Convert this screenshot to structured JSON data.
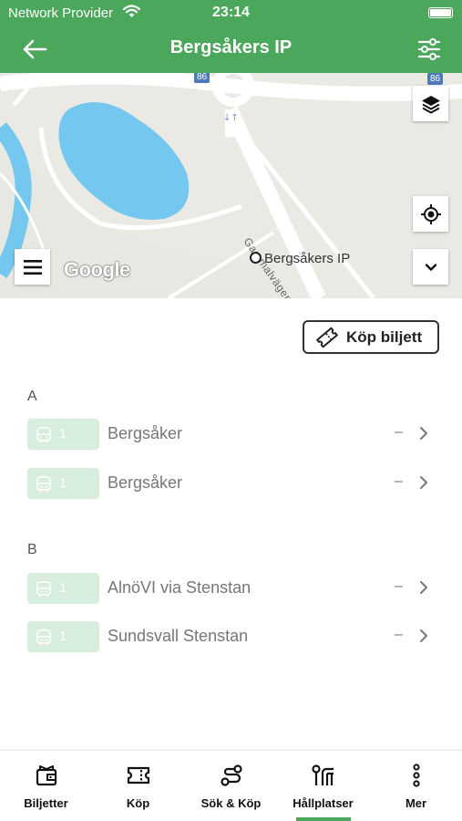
{
  "status_bar": {
    "carrier": "Network Provider",
    "time": "23:14",
    "wifi_icon": "wifi-icon",
    "battery_icon": "battery-icon"
  },
  "nav": {
    "title": "Bergsåkers IP",
    "back_icon": "arrow-left-icon",
    "filter_icon": "sliders-icon"
  },
  "map": {
    "stop_label": "Bergsåkers IP",
    "road_label": "Gammalvägen",
    "road_shield_1": "86",
    "road_shield_2": "86",
    "provider": "Google",
    "layers_icon": "layers-icon",
    "locate_icon": "crosshair-icon",
    "expand_icon": "chevron-down-icon",
    "menu_icon": "hamburger-icon"
  },
  "buy_ticket": {
    "label": "Köp biljett",
    "icon": "ticket-icon"
  },
  "sections": [
    {
      "name": "A",
      "rows": [
        {
          "line": "1",
          "destination": "Bergsåker",
          "time": "–"
        },
        {
          "line": "1",
          "destination": "Bergsåker",
          "time": "–"
        }
      ]
    },
    {
      "name": "B",
      "rows": [
        {
          "line": "1",
          "destination": "AlnöVI via Stenstan",
          "time": "–"
        },
        {
          "line": "1",
          "destination": "Sundsvall Stenstan",
          "time": "–"
        }
      ]
    }
  ],
  "tabs": [
    {
      "label": "Biljetter",
      "icon": "wallet-icon"
    },
    {
      "label": "Köp",
      "icon": "ticket-icon"
    },
    {
      "label": "Sök & Köp",
      "icon": "route-icon"
    },
    {
      "label": "Hållplatser",
      "icon": "stop-sign-icon",
      "active": true
    },
    {
      "label": "Mer",
      "icon": "more-vertical-icon"
    }
  ],
  "colors": {
    "brand_green": "#4ba75c",
    "badge_green": "#d7eddd",
    "lake_blue": "#74c7ef"
  }
}
